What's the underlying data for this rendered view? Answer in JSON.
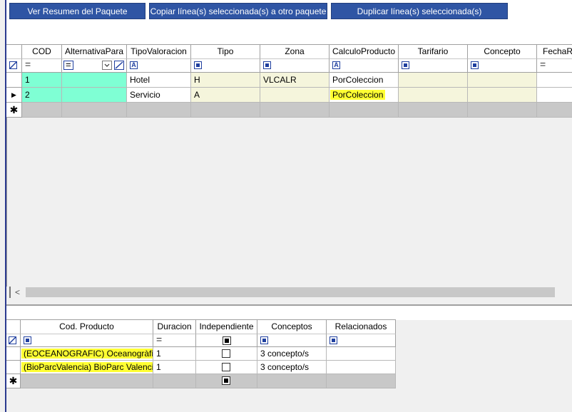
{
  "toolbar": {
    "resumen_label": "Ver Resumen del Paquete",
    "copiar_label": "Copiar línea(s) seleccionada(s) a otro paquete",
    "duplicar_label": "Duplicar línea(s) seleccionada(s)"
  },
  "main_grid": {
    "columns": [
      "COD",
      "AlternativaPara",
      "TipoValoracion",
      "Tipo",
      "Zona",
      "CalculoProducto",
      "Tarifario",
      "Concepto",
      "FechaRe"
    ],
    "rows": [
      {
        "cod": "1",
        "alternativa": "",
        "tipo_valoracion": "Hotel",
        "tipo": "H",
        "zona": "VLCALR",
        "calculo": "PorColeccion",
        "tarifario": "",
        "concepto": ""
      },
      {
        "cod": "2",
        "alternativa": "",
        "tipo_valoracion": "Servicio",
        "tipo": "A",
        "zona": "",
        "calculo": "PorColeccion",
        "tarifario": "",
        "concepto": ""
      }
    ],
    "new_row_marker": "✱",
    "current_row_marker": "▶",
    "scroll_left": "<"
  },
  "detail_grid": {
    "columns": [
      "Cod. Producto",
      "Duracion",
      "Independiente",
      "Conceptos",
      "Relacionados"
    ],
    "rows": [
      {
        "producto": "(EOCEANOGRAFIC) Oceanogràfic",
        "duracion": "1",
        "independiente": false,
        "conceptos": "3 concepto/s",
        "relacionados": ""
      },
      {
        "producto": "(BioParcValencia) BioParc Valencia",
        "duracion": "1",
        "independiente": false,
        "conceptos": "3 concepto/s",
        "relacionados": ""
      }
    ],
    "new_row_marker": "✱"
  },
  "colors": {
    "button_bg": "#2f55a4",
    "teal": "#7fffd4",
    "beige": "#f5f5dc",
    "highlight": "#ffff33"
  }
}
